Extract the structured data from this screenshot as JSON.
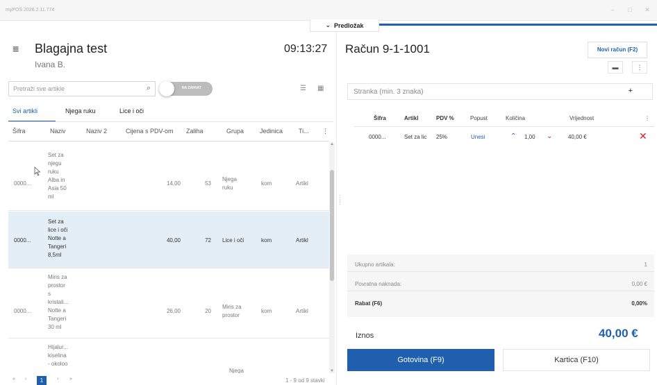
{
  "window": {
    "app_title": "myPOS 2026.2.11.774",
    "controls": {
      "minimize": "–",
      "maximize": "□",
      "close": "✕"
    }
  },
  "template_tab": {
    "chevron": "⌄",
    "label": "Predložak"
  },
  "left": {
    "menu_icon": "≡",
    "store_name": "Blagajna test",
    "user_name": "Ivana B.",
    "clock": "09:13:27",
    "search": {
      "placeholder": "Pretraži sve artikle",
      "icon": "⌕"
    },
    "toggle": {
      "label": "NA ZAHVAT",
      "state": "off"
    },
    "view_icons": {
      "list": "☰",
      "grid": "▦"
    },
    "tabs": [
      {
        "label": "Svi artikli",
        "active": true
      },
      {
        "label": "Njega ruku",
        "active": false
      },
      {
        "label": "Lice i oči",
        "active": false
      }
    ],
    "columns": [
      "Šifra",
      "Naziv",
      "Naziv 2",
      "Cijena s PDV-om",
      "Zaliha",
      "Grupa",
      "Jedinica",
      "Ti...",
      "⋮"
    ],
    "rows": [
      {
        "code": "0000...",
        "name": [
          "Set za",
          "njegu",
          "ruku",
          "Alba in",
          "Asia 50",
          "ml"
        ],
        "price": "14,00",
        "stock": "53",
        "group": [
          "Njega",
          "ruku"
        ],
        "unit": "kom",
        "type": "Artikl",
        "selected": false
      },
      {
        "code": "0000...",
        "name": [
          "Set za",
          "lice i oči",
          "Notte a",
          "Tangeri",
          "8,5ml"
        ],
        "price": "40,00",
        "stock": "72",
        "group": [
          "Lice i oči"
        ],
        "unit": "kom",
        "type": "Artikl",
        "selected": true
      },
      {
        "code": "0000...",
        "name": [
          "Miris za",
          "prostor",
          "s",
          "kristali...",
          "Notte a",
          "Tangeri",
          "30 ml"
        ],
        "price": "26,00",
        "stock": "20",
        "group": [
          "Miris za",
          "prostor"
        ],
        "unit": "kom",
        "type": "Artikl",
        "selected": false
      },
      {
        "code": "",
        "name": [
          "Hijalur...",
          "kiselina",
          "- okoloo"
        ],
        "price": "",
        "stock": "",
        "group": [
          "Njega"
        ],
        "unit": "",
        "type": "",
        "selected": false
      }
    ],
    "pager": {
      "first": "«",
      "prev": "‹",
      "current": "1",
      "next": "›",
      "last": "»",
      "count": "1 - 9 od 9 stavki"
    }
  },
  "right": {
    "invoice_title": "Račun 9-1-1001",
    "new_invoice_label": "Novi račun (F2)",
    "small_buttons": [
      "▬",
      "⋮"
    ],
    "customer": {
      "placeholder": "Stranka (min. 3 znaka)",
      "add_icon": "+"
    },
    "columns": [
      "Šifra",
      "Artikl",
      "PDV %",
      "Popust",
      "Količina",
      "Vrijednost",
      "⋮"
    ],
    "line": {
      "code": "0000...",
      "article": "Set za lic",
      "vat": "25%",
      "discount": "Unesi",
      "up": "⌃",
      "qty": "1,00",
      "down": "⌄",
      "value": "40,00 €",
      "delete": "✕"
    },
    "totals": [
      {
        "label": "Ukupno artikala:",
        "value": "1",
        "bold": false
      },
      {
        "label": "Povratna naknada:",
        "value": "0,00 €",
        "bold": false
      },
      {
        "label": "Rabat (F6)",
        "value": "0,00%",
        "bold": true
      }
    ],
    "amount_label": "Iznos",
    "amount_value": "40,00 €",
    "cash_button": "Gotovina (F9)",
    "card_button": "Kartica (F10)"
  },
  "colors": {
    "accent": "#1f5fae",
    "danger": "#d42020",
    "selected_row": "#e4eef7"
  }
}
